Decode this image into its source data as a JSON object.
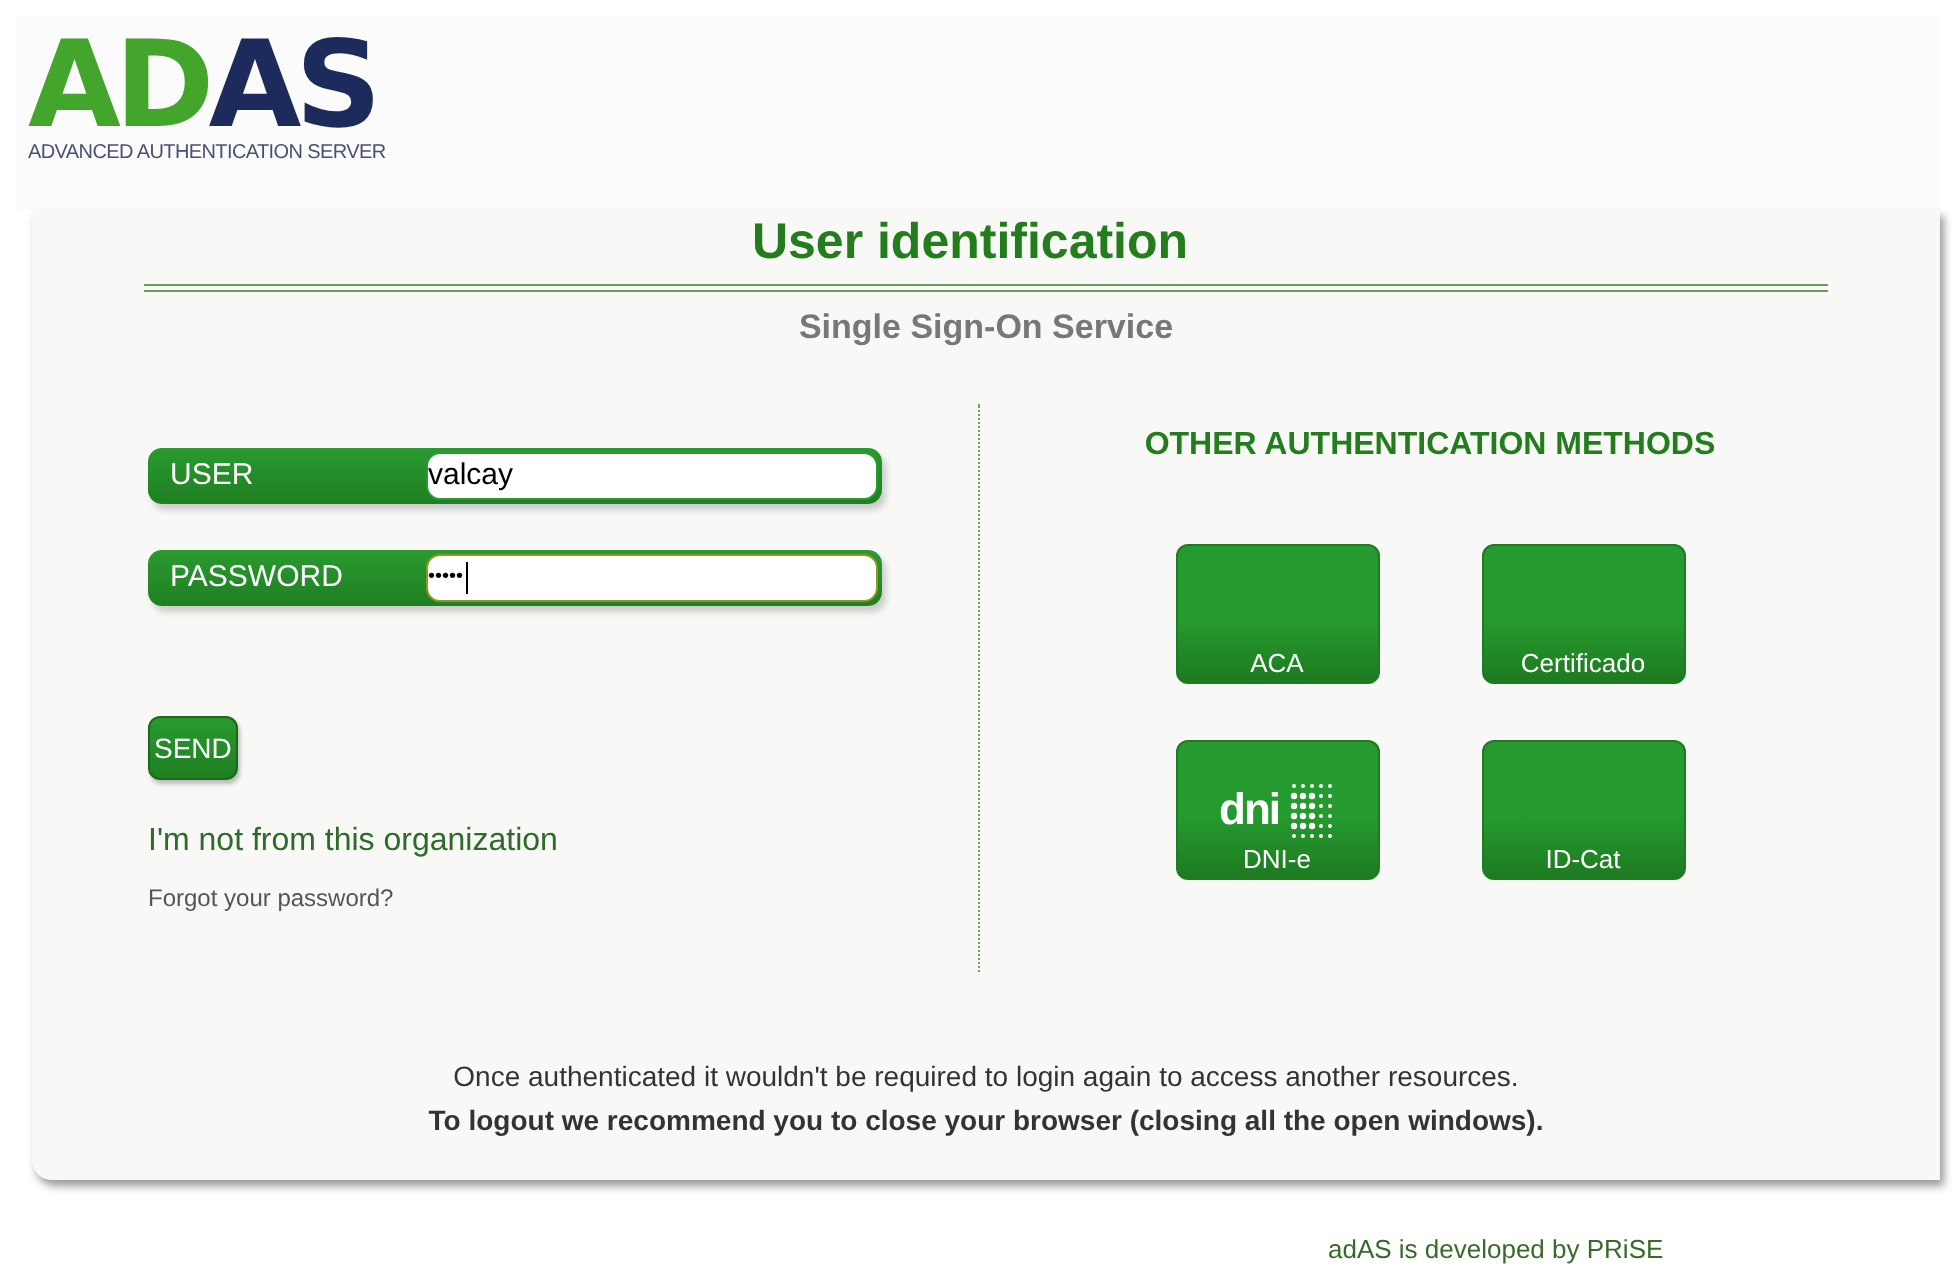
{
  "logo": {
    "part_1": "AD",
    "part_2": "AS",
    "tagline": "ADVANCED AUTHENTICATION SERVER"
  },
  "title": "User identification",
  "subtitle": "Single Sign-On Service",
  "fields": [
    {
      "kind": "text",
      "label": "USER",
      "value": "valcay",
      "focused": false
    },
    {
      "kind": "password",
      "label": "PASSWORD",
      "value": "•••••",
      "focused": true
    }
  ],
  "send_button": "SEND",
  "links": [
    "I'm not from this organization",
    "Forgot your password?"
  ],
  "other_methods": {
    "heading": "OTHER AUTHENTICATION METHODS",
    "methods": [
      {
        "label": "ACA",
        "kind": "plain"
      },
      {
        "label": "Certificado",
        "kind": "plain"
      },
      {
        "label": "DNI-e",
        "kind": "dni",
        "icon_text": "dni"
      },
      {
        "label": "ID-Cat",
        "kind": "plain"
      }
    ]
  },
  "notes": [
    "Once authenticated it wouldn't be required to login again to access another resources.",
    "To logout we recommend you to close your browser (closing all the open windows)."
  ],
  "footer": "adAS is developed by PRiSE"
}
